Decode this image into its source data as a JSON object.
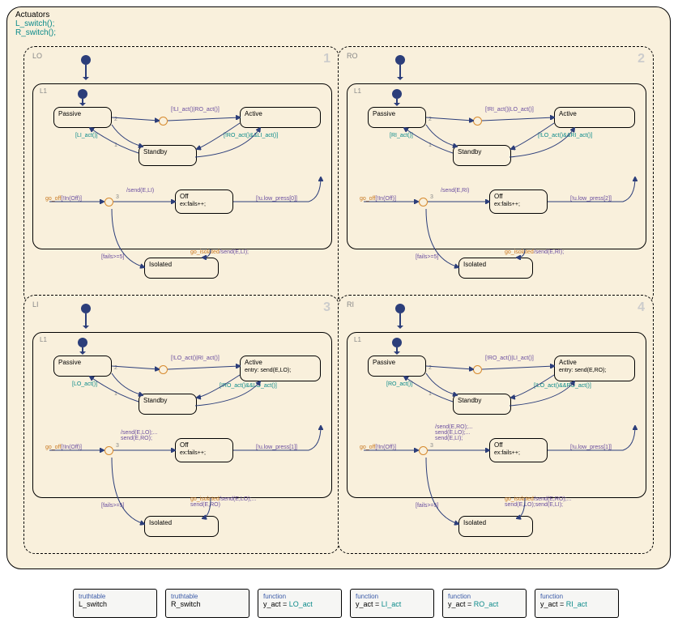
{
  "main": {
    "title": "Actuators",
    "fn1": "L_switch();",
    "fn2": "R_switch();"
  },
  "quadrants": {
    "q1": {
      "label": "LO",
      "num": "1",
      "inner": "L1",
      "passive": "Passive",
      "active": "Active",
      "standby": "Standby",
      "off": "Off",
      "off_sub": "ex:fails++;",
      "isolated": "Isolated",
      "t_top": "[!LI_act()|RO_act()]",
      "t_left": "[LI_act()]",
      "t_right": "[!RO_act()&&LI_act()]",
      "t_go_off": "go_off[!In(Off)]",
      "t_send": "/send(E,LI)",
      "t_low": "[!u.low_press[0]]",
      "t_fails": "[fails>=5]",
      "t_iso": "go_isolated/send(E,LI);",
      "j1": "1",
      "j2": "2",
      "j3": "3"
    },
    "q2": {
      "label": "RO",
      "num": "2",
      "inner": "L1",
      "passive": "Passive",
      "active": "Active",
      "standby": "Standby",
      "off": "Off",
      "off_sub": "ex:fails++;",
      "isolated": "Isolated",
      "t_top": "[!RI_act()|LO_act()]",
      "t_left": "[RI_act()]",
      "t_right": "[!LO_act()&&RI_act()]",
      "t_go_off": "go_off[!In(Off)]",
      "t_send": "/send(E,RI)",
      "t_low": "[!u.low_press[2]]",
      "t_fails": "[fails>=5]",
      "t_iso": "go_isolated/send(E,RI);",
      "j1": "1",
      "j2": "2",
      "j3": "3"
    },
    "q3": {
      "label": "LI",
      "num": "3",
      "inner": "L1",
      "passive": "Passive",
      "active": "Active",
      "active_sub": "entry: send(E,LO);",
      "standby": "Standby",
      "off": "Off",
      "off_sub": "ex:fails++;",
      "isolated": "Isolated",
      "t_top": "[!LO_act()|RI_act()]",
      "t_left": "[LO_act()]",
      "t_right": "[!RO_act()&&LO_act()]",
      "t_go_off": "go_off[!In(Off)]",
      "t_send": "/send(E,LO);...\nsend(E,RO);",
      "t_low": "[!u.low_press[1]]",
      "t_fails": "[fails>=5]",
      "t_iso": "go_isolated/send(E,LO);...\nsend(E,RO)",
      "j1": "1",
      "j2": "2",
      "j3": "3"
    },
    "q4": {
      "label": "RI",
      "num": "4",
      "inner": "L1",
      "passive": "Passive",
      "active": "Active",
      "active_sub": "entry: send(E,RO);",
      "standby": "Standby",
      "off": "Off",
      "off_sub": "ex:fails++;",
      "isolated": "Isolated",
      "t_top": "[!RO_act()|LI_act()]",
      "t_left": "[RO_act()]",
      "t_right": "[!LO_act()&&RO_act()]",
      "t_go_off": "go_off[!In(Off)]",
      "t_send": "/send(E,RO);...\nsend(E,LO);...\nsend(E,LI);",
      "t_low": "[!u.low_press[1]]",
      "t_fails": "[fails>=5]",
      "t_iso": "go_isolated/send(E,RO);...\nsend(E,LO);send(E,LI);",
      "j1": "1",
      "j2": "2",
      "j3": "3"
    }
  },
  "funcs": {
    "f1": {
      "hdr": "truthtable",
      "body": "L_switch"
    },
    "f2": {
      "hdr": "truthtable",
      "body": "R_switch"
    },
    "f3": {
      "hdr": "function",
      "pre": "y_act = ",
      "fn": "LO_act"
    },
    "f4": {
      "hdr": "function",
      "pre": "y_act = ",
      "fn": "LI_act"
    },
    "f5": {
      "hdr": "function",
      "pre": "y_act = ",
      "fn": "RO_act"
    },
    "f6": {
      "hdr": "function",
      "pre": "y_act = ",
      "fn": "RI_act"
    }
  }
}
